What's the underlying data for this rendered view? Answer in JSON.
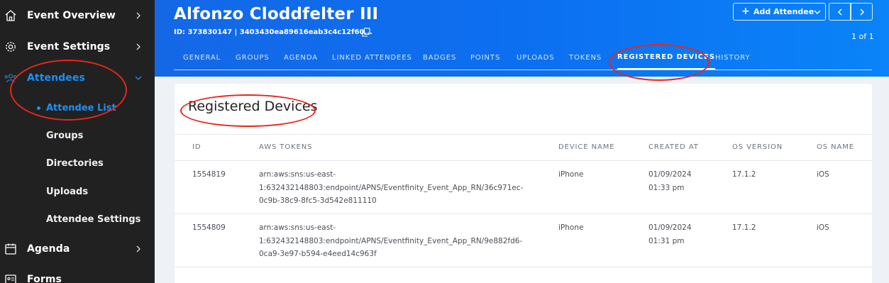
{
  "sidebar": {
    "items": [
      {
        "label": "Event Overview",
        "icon": "home-icon"
      },
      {
        "label": "Event Settings",
        "icon": "gear-icon"
      },
      {
        "label": "Attendees",
        "icon": "people-icon"
      },
      {
        "label": "Agenda",
        "icon": "calendar-icon"
      },
      {
        "label": "Forms",
        "icon": "id-card-icon"
      }
    ],
    "sub_items": [
      {
        "label": "Attendee List"
      },
      {
        "label": "Groups"
      },
      {
        "label": "Directories"
      },
      {
        "label": "Uploads"
      },
      {
        "label": "Attendee Settings"
      }
    ]
  },
  "header": {
    "title": "Alfonzo Cloddfelter III",
    "id_line": "ID: 373830147 | 3403430ea89616eab3c4c12f60...",
    "add_button": "Add Attendee",
    "page_count": "1 of 1",
    "tabs": [
      {
        "label": "GENERAL"
      },
      {
        "label": "GROUPS"
      },
      {
        "label": "AGENDA"
      },
      {
        "label": "LINKED ATTENDEES"
      },
      {
        "label": "BADGES"
      },
      {
        "label": "POINTS"
      },
      {
        "label": "UPLOADS"
      },
      {
        "label": "TOKENS"
      },
      {
        "label": "REGISTERED DEVICES"
      },
      {
        "label": "HISTORY"
      }
    ]
  },
  "main": {
    "title": "Registered Devices",
    "columns": [
      "ID",
      "AWS TOKENS",
      "DEVICE NAME",
      "CREATED AT",
      "OS VERSION",
      "OS NAME"
    ],
    "rows": [
      {
        "id": "1554819",
        "token_lines": [
          "arn:aws:sns:us-east-",
          "1:632432148803:endpoint/APNS/Eventfinity_Event_App_RN/36c971ec-",
          "0c9b-38c9-8fc5-3d542e811110"
        ],
        "device": "iPhone",
        "created_date": "01/09/2024",
        "created_time": "01:33 pm",
        "os_version": "17.1.2",
        "os_name": "iOS"
      },
      {
        "id": "1554809",
        "token_lines": [
          "arn:aws:sns:us-east-",
          "1:632432148803:endpoint/APNS/Eventfinity_Event_App_RN/9e882fd6-",
          "0ca9-3e97-b594-e4eed14c963f"
        ],
        "device": "iPhone",
        "created_date": "01/09/2024",
        "created_time": "01:31 pm",
        "os_version": "17.1.2",
        "os_name": "iOS"
      }
    ]
  },
  "colors": {
    "accent": "#1f8ff3",
    "sidebar_bg": "#212121",
    "header_bg": "#0c6ff0",
    "annotation": "#e8261a"
  }
}
